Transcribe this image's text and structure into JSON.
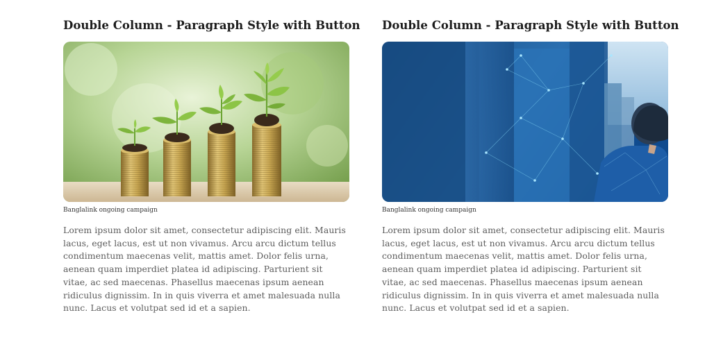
{
  "columns": [
    {
      "title": "Double Column - Paragraph Style with Button",
      "image": "coin-stacks-with-plant-sprouts",
      "caption": "Banglalink ongoing campaign",
      "paragraph": "Lorem ipsum dolor sit amet, consectetur adipiscing elit. Mauris lacus, eget lacus, est ut non vivamus. Arcu arcu dictum tellus condimentum maecenas velit, mattis amet. Dolor felis urna, aenean quam imperdiet platea id adipiscing. Parturient sit vitae, ac sed maecenas. Phasellus maecenas ipsum aenean ridiculus dignissim. In in quis viverra et amet malesuada nulla nunc. Lacus et volutpat sed id et a sapien."
    },
    {
      "title": "Double Column - Paragraph Style with Button",
      "image": "businessman-city-network-overlay",
      "caption": "Banglalink ongoing campaign",
      "paragraph": "Lorem ipsum dolor sit amet, consectetur adipiscing elit. Mauris lacus, eget lacus, est ut non vivamus. Arcu arcu dictum tellus condimentum maecenas velit, mattis amet. Dolor felis urna, aenean quam imperdiet platea id adipiscing. Parturient sit vitae, ac sed maecenas. Phasellus maecenas ipsum aenean ridiculus dignissim. In in quis viverra et amet malesuada nulla nunc. Lacus et volutpat sed id et a sapien."
    }
  ]
}
